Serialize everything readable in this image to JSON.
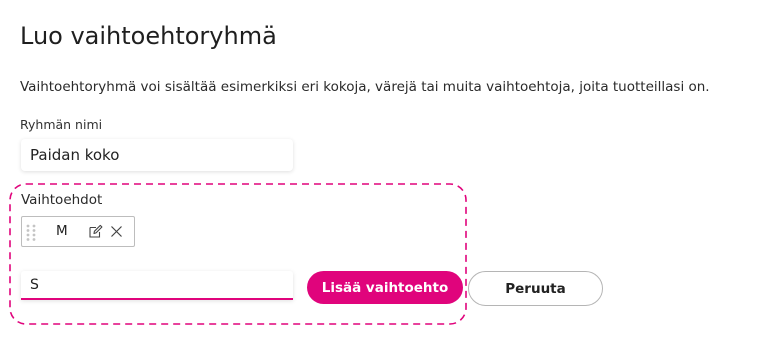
{
  "page": {
    "title": "Luo vaihtoehtoryhmä",
    "description": "Vaihtoehtoryhmä voi sisältää esimerkiksi eri kokoja, värejä tai muita vaihtoehtoja, joita tuotteillasi on."
  },
  "group_name": {
    "label": "Ryhmän nimi",
    "value": "Paidan koko"
  },
  "options": {
    "label": "Vaihtoehdot",
    "items": [
      {
        "label": "M",
        "icons": [
          "drag-handle-icon",
          "edit-icon",
          "close-icon"
        ]
      }
    ],
    "new_option_value": "S",
    "add_button_label": "Lisää vaihtoehto",
    "cancel_button_label": "Peruuta"
  },
  "colors": {
    "accent": "#e0047c",
    "text": "#222222",
    "border": "#bdbdbd"
  }
}
